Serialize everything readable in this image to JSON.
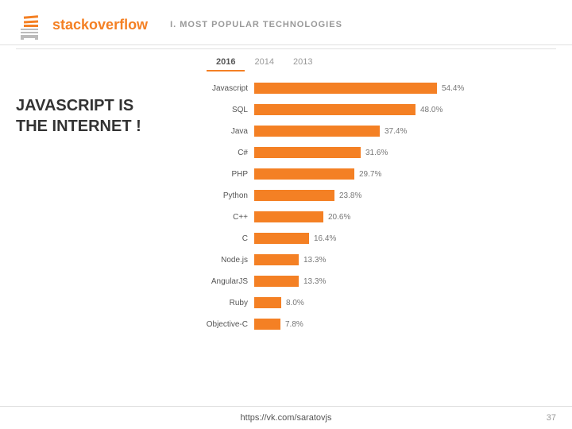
{
  "header": {
    "logo_text_plain": "stack",
    "logo_text_accent": "overflow",
    "slide_title": "I. MOST POPULAR TECHNOLOGIES"
  },
  "year_tabs": [
    {
      "label": "2016",
      "active": true
    },
    {
      "label": "2014",
      "active": false
    },
    {
      "label": "2013",
      "active": false
    }
  ],
  "left_panel": {
    "line1": "JAVASCRIPT IS",
    "line2": "THE INTERNET !"
  },
  "chart": {
    "items": [
      {
        "label": "Javascript",
        "value": "54.4%",
        "pct": 54.4
      },
      {
        "label": "SQL",
        "value": "48.0%",
        "pct": 48.0
      },
      {
        "label": "Java",
        "value": "37.4%",
        "pct": 37.4
      },
      {
        "label": "C#",
        "value": "31.6%",
        "pct": 31.6
      },
      {
        "label": "PHP",
        "value": "29.7%",
        "pct": 29.7
      },
      {
        "label": "Python",
        "value": "23.8%",
        "pct": 23.8
      },
      {
        "label": "C++",
        "value": "20.6%",
        "pct": 20.6
      },
      {
        "label": "C",
        "value": "16.4%",
        "pct": 16.4
      },
      {
        "label": "Node.js",
        "value": "13.3%",
        "pct": 13.3
      },
      {
        "label": "AngularJS",
        "value": "13.3%",
        "pct": 13.3
      },
      {
        "label": "Ruby",
        "value": "8.0%",
        "pct": 8.0
      },
      {
        "label": "Objective-C",
        "value": "7.8%",
        "pct": 7.8
      }
    ],
    "max_bar_width": 230
  },
  "footer": {
    "url": "https://vk.com/saratovjs",
    "slide_number": "37"
  }
}
